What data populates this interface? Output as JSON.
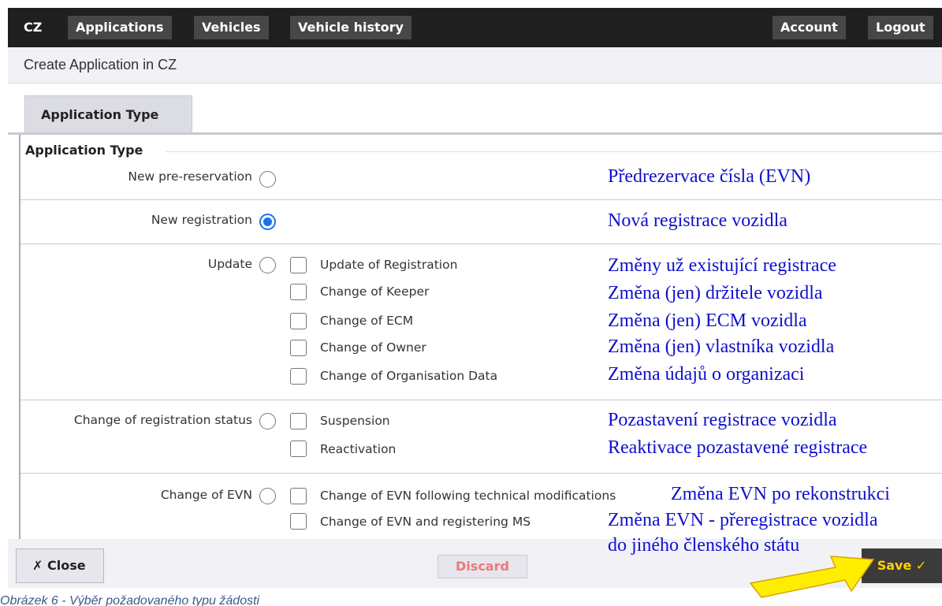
{
  "nav": {
    "country": "CZ",
    "applications": "Applications",
    "vehicles": "Vehicles",
    "vehicle_history": "Vehicle history",
    "account": "Account",
    "logout": "Logout"
  },
  "header": {
    "title": "Create Application in CZ"
  },
  "tab": {
    "label": "Application Type"
  },
  "form": {
    "legend": "Application Type",
    "new_pre_reservation": {
      "label": "New pre-reservation",
      "checked": false,
      "note": "Předrezervace čísla (EVN)"
    },
    "new_registration": {
      "label": "New registration",
      "checked": true,
      "note": "Nová registrace vozidla"
    },
    "update": {
      "label": "Update",
      "checked": false,
      "options": [
        {
          "label": "Update of Registration",
          "note": "Změny už existující registrace"
        },
        {
          "label": "Change of Keeper",
          "note": "Změna (jen) držitele vozidla"
        },
        {
          "label": "Change of ECM",
          "note": "Změna (jen) ECM vozidla"
        },
        {
          "label": "Change of Owner",
          "note": "Změna (jen) vlastníka vozidla"
        },
        {
          "label": "Change of Organisation Data",
          "note": "Změna údajů o organizaci"
        }
      ]
    },
    "status": {
      "label": "Change of registration status",
      "checked": false,
      "options": [
        {
          "label": "Suspension",
          "note": "Pozastavení registrace vozidla"
        },
        {
          "label": "Reactivation",
          "note": "Reaktivace pozastavené registrace"
        }
      ]
    },
    "evn": {
      "label": "Change of EVN",
      "checked": false,
      "options": [
        {
          "label": "Change of EVN following technical modifications",
          "note": "Změna EVN po rekonstrukci"
        },
        {
          "label": "Change of EVN and registering MS",
          "note": "Změna EVN - přeregistrace vozidla"
        }
      ],
      "note_extra": "do jiného členského státu"
    }
  },
  "footer": {
    "close": "✗ Close",
    "discard": "Discard",
    "save": "Save ✓"
  },
  "caption": "Obrázek 6 - Výběr požadovaného typu žádosti",
  "colors": {
    "note": "#1010cc",
    "radio_selected": "#1a73e8",
    "arrow": "#ffee00",
    "save_text": "#ffd200"
  }
}
